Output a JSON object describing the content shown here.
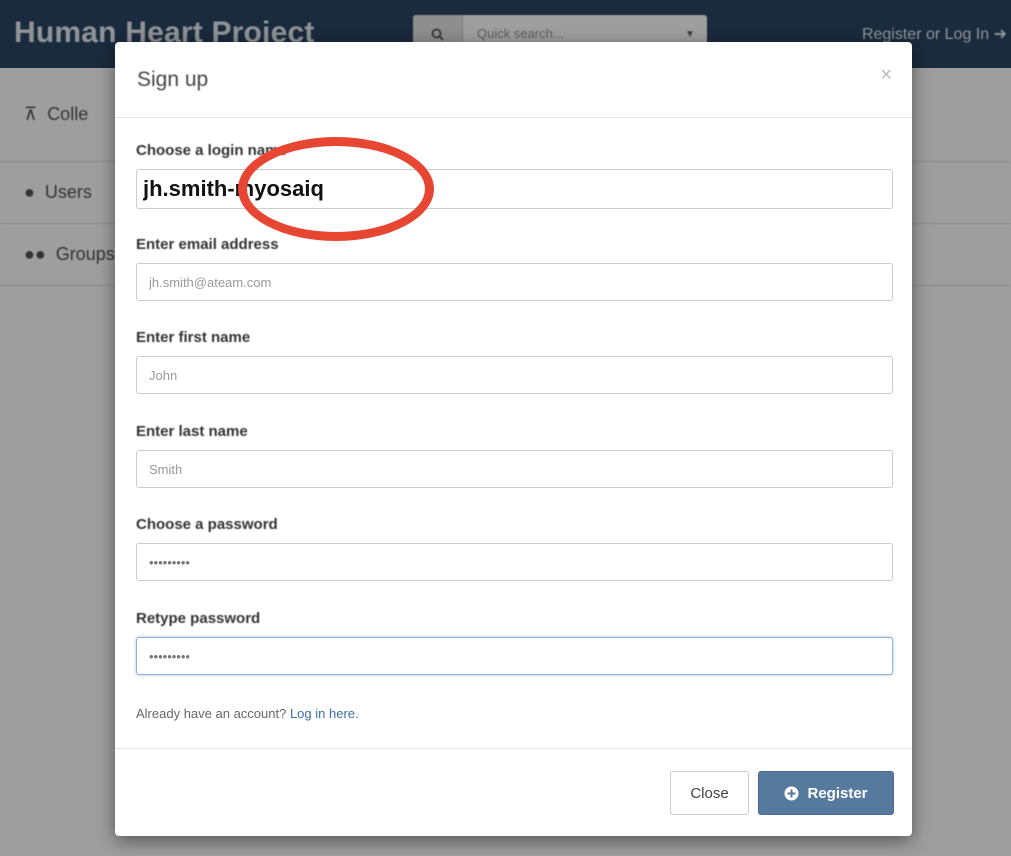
{
  "header": {
    "brand": "Human Heart Project",
    "search_placeholder": "Quick search...",
    "auth_link": "Register or Log In"
  },
  "sidebar": {
    "items": [
      {
        "label": "Colle",
        "icon": "sitemap-icon"
      },
      {
        "label": "Users",
        "icon": "user-icon"
      },
      {
        "label": "Groups",
        "icon": "users-icon"
      }
    ]
  },
  "modal": {
    "title": "Sign up",
    "close_symbol": "×",
    "fields": {
      "login_label": "Choose a login name",
      "login_value": "jh.smith-myosaiq",
      "email_label": "Enter email address",
      "email_placeholder": "jh.smith@ateam.com",
      "first_label": "Enter first name",
      "first_placeholder": "John",
      "last_label": "Enter last name",
      "last_placeholder": "Smith",
      "password_label": "Choose a password",
      "password_value": "•••••••••",
      "retype_label": "Retype password",
      "retype_value": "•••••••••"
    },
    "already_text": "Already have an account?",
    "login_link": "Log in here.",
    "close_button": "Close",
    "register_button": "Register"
  },
  "colors": {
    "topbar": "#2a4663",
    "primary_button": "#56799e",
    "annotation": "#e64632",
    "link": "#3a6fa8"
  }
}
